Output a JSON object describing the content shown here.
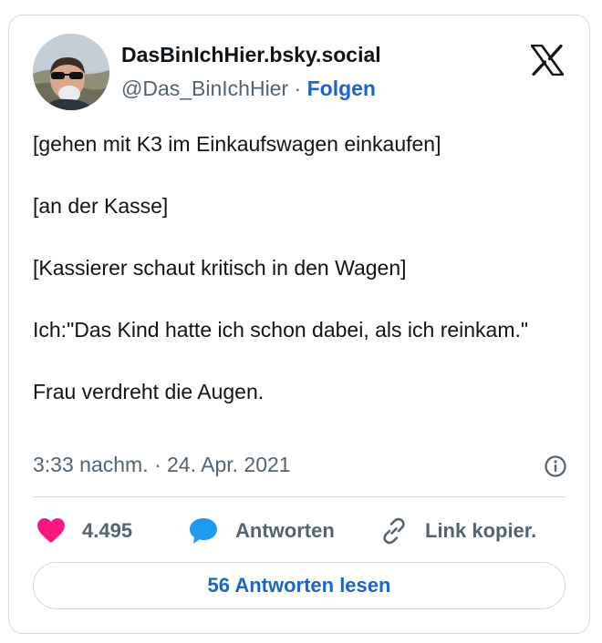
{
  "author": {
    "name": "DasBinIchHier.bsky.social",
    "handle": "@Das_BinIchHier",
    "separator": "·",
    "follow_label": "Folgen"
  },
  "brand": {
    "logo_icon": "x-logo-icon"
  },
  "tweet": {
    "paragraphs": [
      "[gehen mit K3 im Einkaufswagen einkaufen]",
      "[an der Kasse]",
      "[Kassierer schaut kritisch in den Wagen]",
      "Ich:\"Das Kind hatte ich schon dabei, als ich reinkam.\"",
      "Frau verdreht die Augen."
    ],
    "timestamp": "3:33 nachm. · 24. Apr. 2021"
  },
  "actions": {
    "like_count": "4.495",
    "reply_label": "Antworten",
    "copy_label": "Link kopier."
  },
  "read_replies_label": "56 Antworten lesen",
  "colors": {
    "accent": "#1d65c1",
    "like": "#f91880",
    "reply": "#1d9bf0",
    "muted": "#536471",
    "border": "#cfd9de"
  }
}
